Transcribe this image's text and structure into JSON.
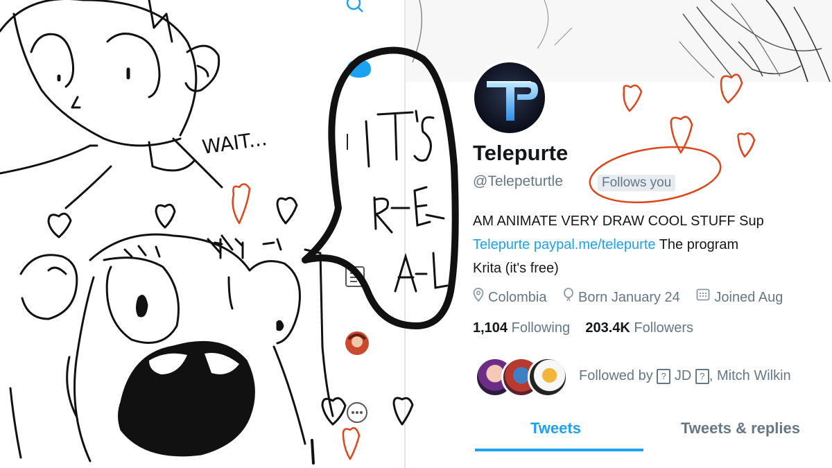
{
  "profile": {
    "name": "Telepurte",
    "handle": "@Telepeturtle",
    "follows_badge": "Follows you",
    "bio_line1": "AM ANIMATE VERY DRAW COOL STUFF Sup",
    "bio_link1": "Telepurte",
    "bio_link2": "paypal.me/telepurte",
    "bio_line2_rest": " The program",
    "bio_line3": "Krita (it's free)",
    "location": "Colombia",
    "birthday": "Born January 24",
    "joined": "Joined Aug",
    "following_count": "1,104",
    "following_label": "Following",
    "followers_count": "203.4K",
    "followers_label": "Followers",
    "followed_by_prefix": "Followed by",
    "followed_by_1": "JD",
    "followed_by_2": ", Mitch Wilkin",
    "tabs": [
      "Tweets",
      "Tweets & replies"
    ]
  },
  "comic": {
    "wait_text": "WAIT...",
    "bubble_text": "IT'S R-E-A-L"
  },
  "colors": {
    "twitter_blue": "#1da1f2",
    "text_dark": "#14171a",
    "text_gray": "#657786",
    "heart_orange": "#e0441a",
    "ink": "#111111"
  },
  "icons": [
    "search-icon",
    "messages-icon",
    "bookmark-icon",
    "lists-icon",
    "profile-avatar-icon",
    "more-icon",
    "location-icon",
    "balloon-icon",
    "calendar-icon"
  ]
}
